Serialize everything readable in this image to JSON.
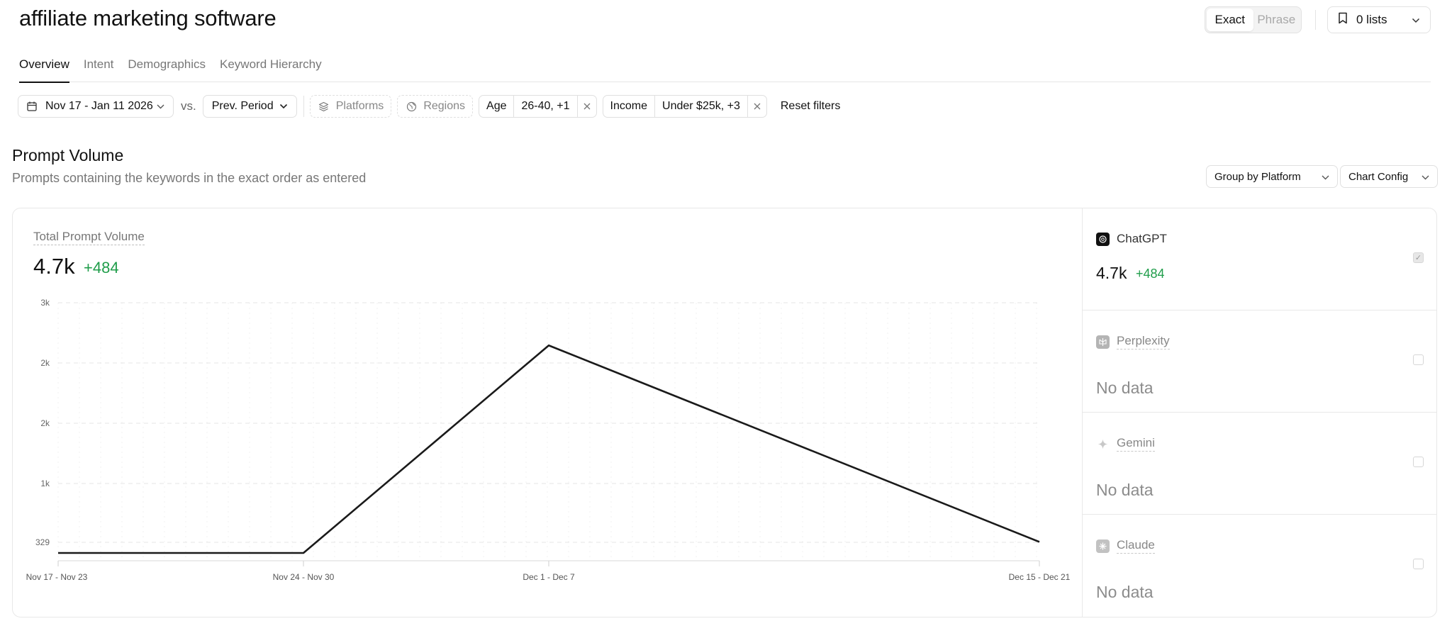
{
  "page": {
    "title": "affiliate marketing software"
  },
  "header": {
    "match_options": [
      "Exact",
      "Phrase"
    ],
    "match_selected": "Exact",
    "lists_label": "0 lists"
  },
  "tabs": [
    {
      "label": "Overview",
      "active": true
    },
    {
      "label": "Intent",
      "active": false
    },
    {
      "label": "Demographics",
      "active": false
    },
    {
      "label": "Keyword Hierarchy",
      "active": false
    }
  ],
  "filters": {
    "date_range": "Nov 17 - Jan 11 2026",
    "vs_label": "vs.",
    "comparison": "Prev. Period",
    "platforms_label": "Platforms",
    "regions_label": "Regions",
    "age": {
      "label": "Age",
      "value": "26-40, +1"
    },
    "income": {
      "label": "Income",
      "value": "Under $25k, +3"
    },
    "reset_label": "Reset filters"
  },
  "section": {
    "title": "Prompt Volume",
    "subtitle": "Prompts containing the keywords in the exact order as entered",
    "group_by_label": "Group by Platform",
    "chart_config_label": "Chart Config"
  },
  "metric": {
    "label": "Total Prompt Volume",
    "value": "4.7k",
    "delta": "+484"
  },
  "chart_data": {
    "type": "line",
    "categories": [
      "Nov 17 - Nov 23",
      "Nov 24 - Nov 30",
      "Dec 1 - Dec 7",
      "Dec 15 - Dec 21"
    ],
    "values": [
      329,
      329,
      2524,
      334
    ],
    "y_ticks": [
      "3k",
      "2k",
      "2k",
      "1k",
      "329"
    ],
    "ylim": [
      0,
      3000
    ],
    "grid": true,
    "line_color": "#1a1a1a"
  },
  "platforms": [
    {
      "name": "ChatGPT",
      "value": "4.7k",
      "delta": "+484",
      "active": true,
      "icon": "chatgpt-logo-icon",
      "logo_color": "#111111"
    },
    {
      "name": "Perplexity",
      "nodata": "No data",
      "active": false,
      "icon": "perplexity-logo-icon",
      "logo_color": "#b4b4b4"
    },
    {
      "name": "Gemini",
      "nodata": "No data",
      "active": false,
      "icon": "gemini-logo-icon",
      "logo_color": "#c8c8c8"
    },
    {
      "name": "Claude",
      "nodata": "No data",
      "active": false,
      "icon": "claude-logo-icon",
      "logo_color": "#c2c2c2"
    }
  ],
  "colors": {
    "positive": "#1f9d4a",
    "border": "#e6e6e6",
    "text_muted": "#777777"
  }
}
